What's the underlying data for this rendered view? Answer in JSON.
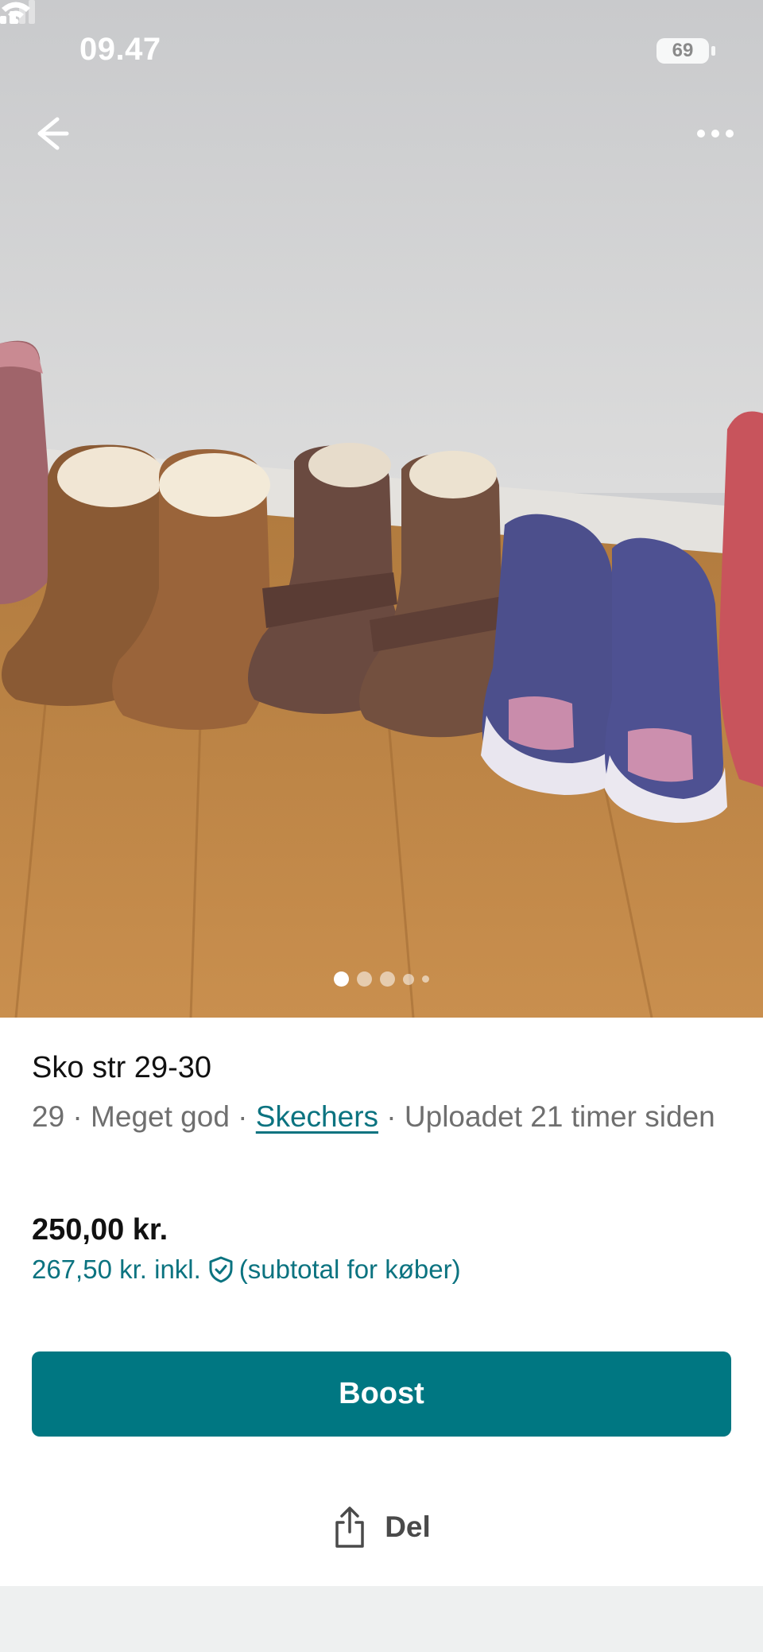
{
  "status_bar": {
    "time": "09.47",
    "battery": "69"
  },
  "photo": {
    "description_icons": [
      "back-arrow-icon",
      "more-dots-icon"
    ],
    "carousel": {
      "total": 5,
      "current": 1
    }
  },
  "listing": {
    "title": "Sko str 29-30",
    "size": "29",
    "sep1": " · ",
    "condition": "Meget god",
    "sep2": " · ",
    "brand": "Skechers",
    "uploaded": " · Uploadet 21 timer siden",
    "price": "250,00 kr.",
    "price_incl": "267,50 kr. inkl.",
    "price_incl_note": "(subtotal for køber)"
  },
  "actions": {
    "boost_label": "Boost",
    "share_label": "Del"
  },
  "colors": {
    "accent": "#007782",
    "accent_text": "#0b7380"
  }
}
